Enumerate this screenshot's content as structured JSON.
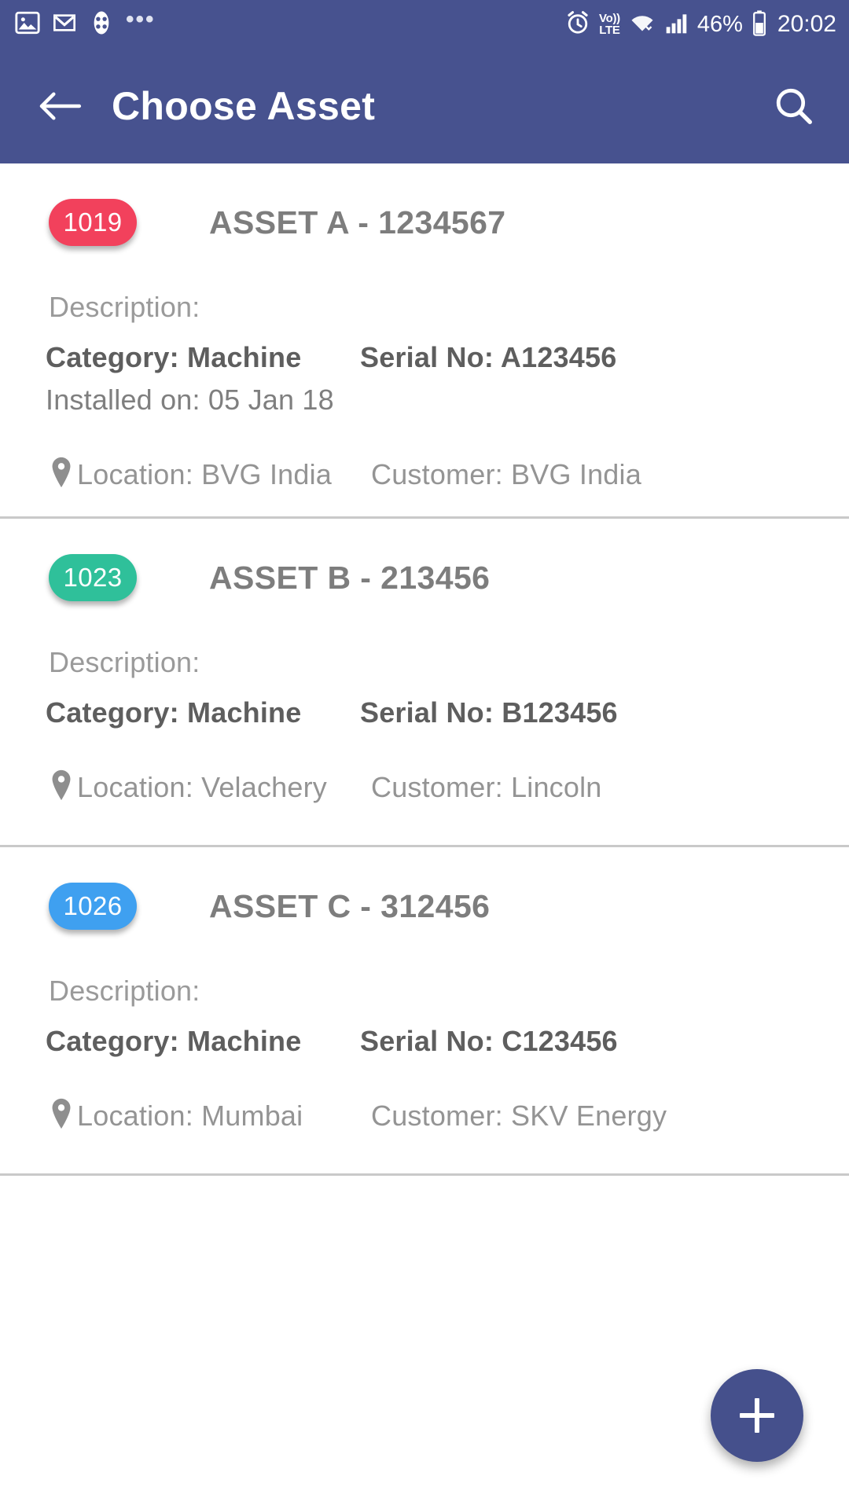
{
  "status_bar": {
    "left_icons": [
      "photos-icon",
      "gmail-icon",
      "clover-app-icon",
      "more-dots-icon"
    ],
    "right_icons": [
      "alarm-clock-icon",
      "volte-icon",
      "wifi-icon",
      "signal-bars-icon",
      "battery-icon"
    ],
    "volte_top": "Vo))",
    "volte_bottom": "LTE",
    "battery_percent": "46%",
    "time": "20:02"
  },
  "app_bar": {
    "back_icon": "arrow-left-icon",
    "title": "Choose Asset",
    "search_icon": "search-icon",
    "background_color": "#47528f"
  },
  "assets": [
    {
      "badge": "1019",
      "badge_color": "#f2415c",
      "title": "ASSET A - 1234567",
      "description_label": "Description:",
      "category": "Category: Machine",
      "serial": "Serial No: A123456",
      "installed": "Installed on: 05 Jan 18",
      "location": "Location: BVG India",
      "customer": "Customer: BVG India"
    },
    {
      "badge": "1023",
      "badge_color": "#2fc09a",
      "title": "ASSET B - 213456",
      "description_label": "Description:",
      "category": "Category: Machine",
      "serial": "Serial No: B123456",
      "installed": "",
      "location": "Location: Velachery",
      "customer": "Customer: Lincoln"
    },
    {
      "badge": "1026",
      "badge_color": "#3fa0f0",
      "title": "ASSET C - 312456",
      "description_label": "Description:",
      "category": "Category: Machine",
      "serial": "Serial No: C123456",
      "installed": "",
      "location": "Location: Mumbai",
      "customer": "Customer: SKV Energy"
    }
  ],
  "fab": {
    "icon": "plus-icon",
    "color": "#45508c"
  }
}
